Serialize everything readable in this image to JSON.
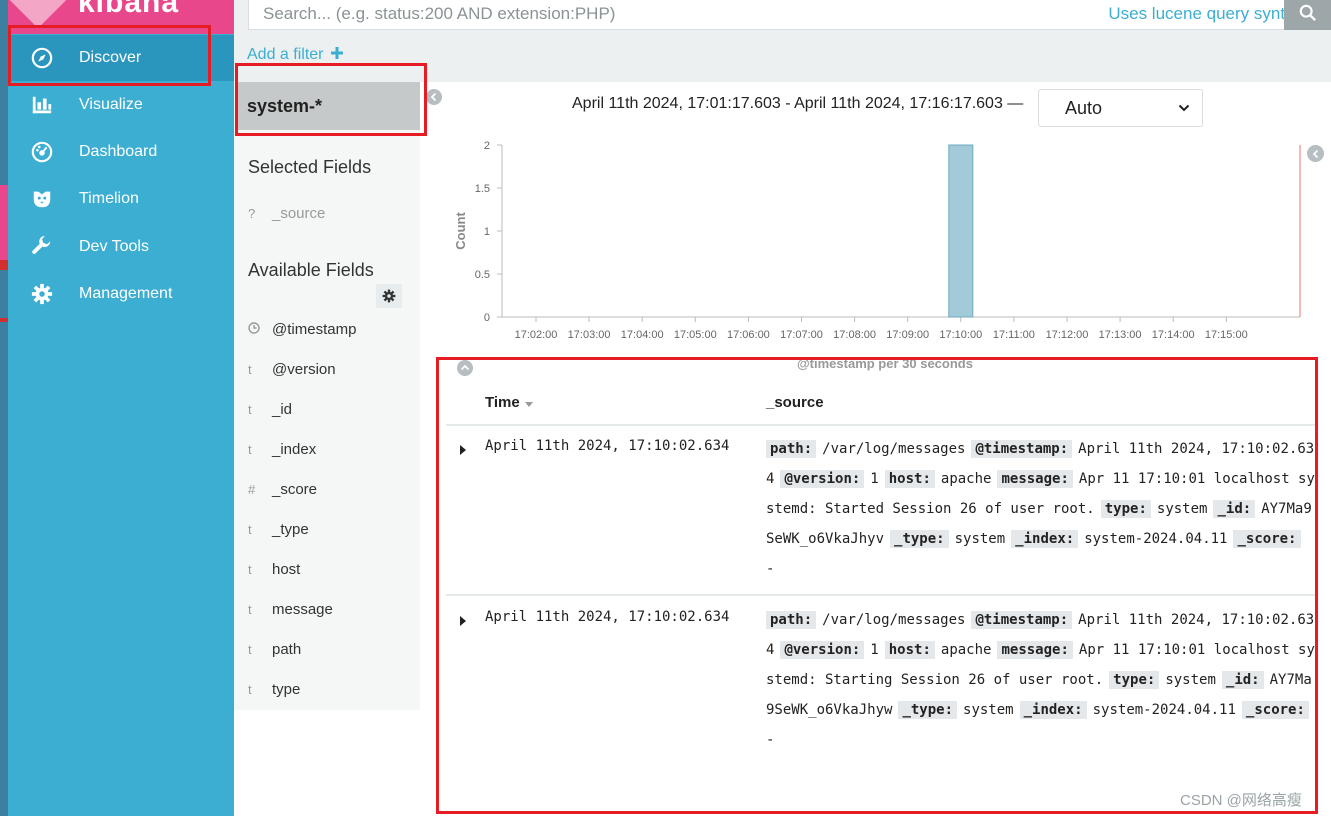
{
  "brand": {
    "name": "kibana"
  },
  "sidebar": {
    "items": [
      {
        "label": "Discover",
        "icon": "compass-icon"
      },
      {
        "label": "Visualize",
        "icon": "bar-chart-icon"
      },
      {
        "label": "Dashboard",
        "icon": "dashboard-icon"
      },
      {
        "label": "Timelion",
        "icon": "timelion-icon"
      },
      {
        "label": "Dev Tools",
        "icon": "wrench-icon"
      },
      {
        "label": "Management",
        "icon": "gear-icon"
      }
    ]
  },
  "search": {
    "placeholder": "Search... (e.g. status:200 AND extension:PHP)",
    "syntax_hint": "Uses lucene query syntax"
  },
  "filters": {
    "add_label": "Add a filter",
    "add_icon": "plus-icon"
  },
  "index_pattern": "system-*",
  "fields": {
    "selected_title": "Selected Fields",
    "selected": [
      {
        "type": "?",
        "name": "_source"
      }
    ],
    "available_title": "Available Fields",
    "available": [
      {
        "type": "clock",
        "name": "@timestamp"
      },
      {
        "type": "t",
        "name": "@version"
      },
      {
        "type": "t",
        "name": "_id"
      },
      {
        "type": "t",
        "name": "_index"
      },
      {
        "type": "#",
        "name": "_score"
      },
      {
        "type": "t",
        "name": "_type"
      },
      {
        "type": "t",
        "name": "host"
      },
      {
        "type": "t",
        "name": "message"
      },
      {
        "type": "t",
        "name": "path"
      },
      {
        "type": "t",
        "name": "type"
      }
    ]
  },
  "histogram": {
    "time_range": "April 11th 2024, 17:01:17.603 - April 11th 2024, 17:16:17.603 —",
    "interval": "Auto"
  },
  "chart_data": {
    "type": "bar",
    "ylabel": "Count",
    "xlabel": "@timestamp per 30 seconds",
    "ylim": [
      0,
      2
    ],
    "y_ticks": [
      "0",
      "0.5",
      "1",
      "1.5",
      "2"
    ],
    "x_ticks": [
      "17:02:00",
      "17:03:00",
      "17:04:00",
      "17:05:00",
      "17:06:00",
      "17:07:00",
      "17:08:00",
      "17:09:00",
      "17:10:00",
      "17:11:00",
      "17:12:00",
      "17:13:00",
      "17:14:00",
      "17:15:00"
    ],
    "bars": [
      {
        "x": "17:10:00",
        "value": 2
      }
    ],
    "bar_color": "#a3cad9",
    "grid": false
  },
  "documents": {
    "columns": {
      "time": "Time",
      "source": "_source"
    },
    "rows": [
      {
        "time": "April 11th 2024, 17:10:02.634",
        "fields": [
          {
            "k": "path:",
            "v": "/var/log/messages"
          },
          {
            "k": "@timestamp:",
            "v": "April 11th 2024, 17:10:02.634"
          },
          {
            "k": "@version:",
            "v": "1"
          },
          {
            "k": "host:",
            "v": "apache"
          },
          {
            "k": "message:",
            "v": "Apr 11 17:10:01 localhost systemd: Started Session 26 of user root."
          },
          {
            "k": "type:",
            "v": "system"
          },
          {
            "k": "_id:",
            "v": "AY7Ma9SeWK_o6VkaJhyv"
          },
          {
            "k": "_type:",
            "v": "system"
          },
          {
            "k": "_index:",
            "v": "system-2024.04.11"
          },
          {
            "k": "_score:",
            "v": " -"
          }
        ]
      },
      {
        "time": "April 11th 2024, 17:10:02.634",
        "fields": [
          {
            "k": "path:",
            "v": "/var/log/messages"
          },
          {
            "k": "@timestamp:",
            "v": "April 11th 2024, 17:10:02.634"
          },
          {
            "k": "@version:",
            "v": "1"
          },
          {
            "k": "host:",
            "v": "apache"
          },
          {
            "k": "message:",
            "v": "Apr 11 17:10:01 localhost systemd: Starting Session 26 of user root."
          },
          {
            "k": "type:",
            "v": "system"
          },
          {
            "k": "_id:",
            "v": "AY7Ma9SeWK_o6VkaJhyw"
          },
          {
            "k": "_type:",
            "v": "system"
          },
          {
            "k": "_index:",
            "v": "system-2024.04.11"
          },
          {
            "k": "_score:",
            "v": " -"
          }
        ]
      }
    ]
  },
  "watermark": "CSDN @网络高瘦"
}
